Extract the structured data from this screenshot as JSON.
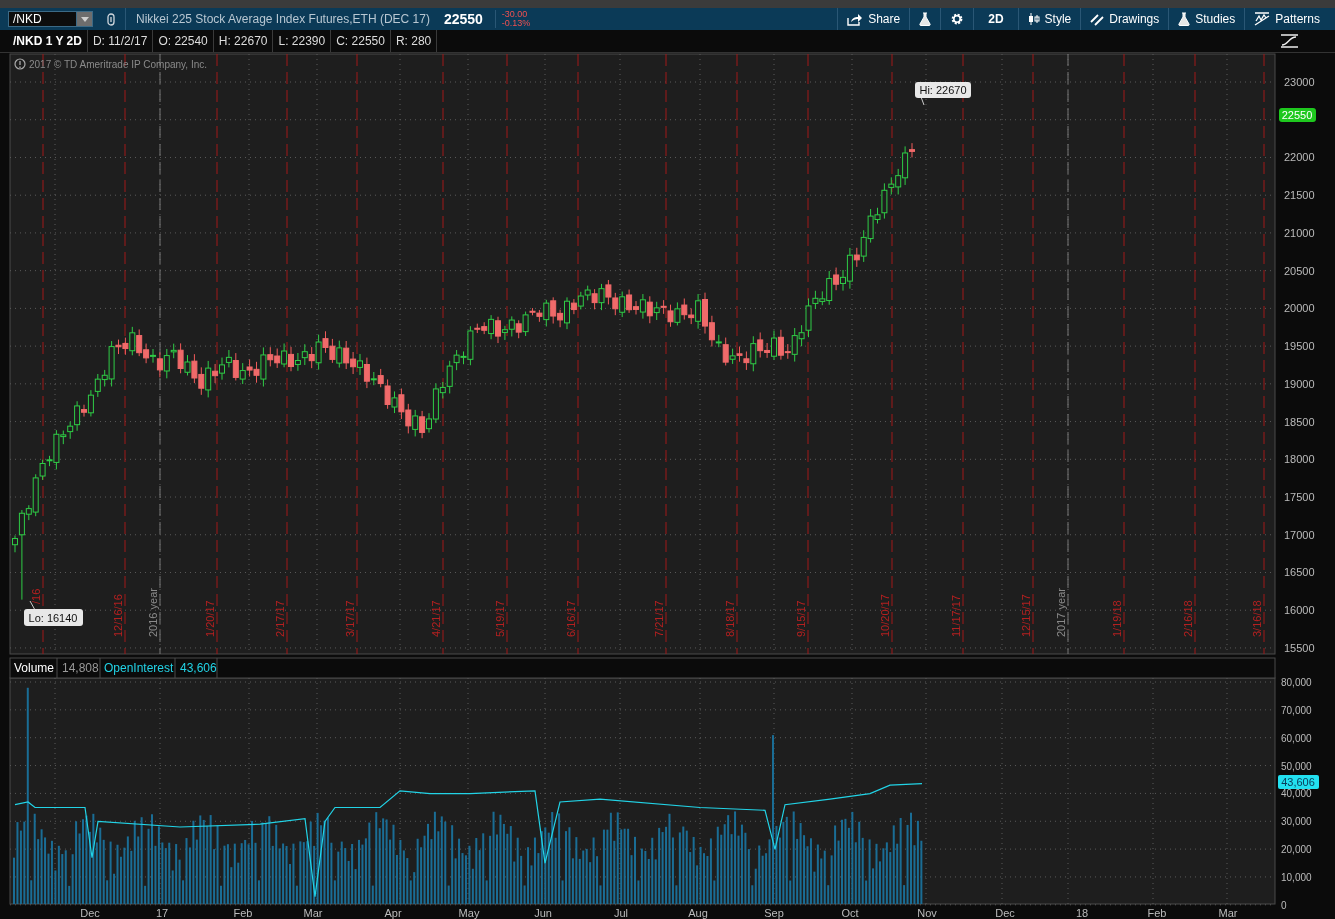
{
  "toolbar": {
    "symbol": "/NKD",
    "description": "Nikkei 225 Stock Average Index Futures,ETH (DEC 17)",
    "last": "22550",
    "change": "-30.00",
    "change_pct": "-0.13%",
    "buttons": [
      {
        "kind": "share",
        "label": "Share"
      },
      {
        "kind": "flask"
      },
      {
        "kind": "gear"
      },
      {
        "kind": "aggregation",
        "label": "2D"
      },
      {
        "kind": "style",
        "label": "Style"
      },
      {
        "kind": "drawings",
        "label": "Drawings"
      },
      {
        "kind": "studies",
        "label": "Studies"
      },
      {
        "kind": "patterns",
        "label": "Patterns"
      }
    ]
  },
  "header": {
    "title": "/NKD 1 Y 2D",
    "stats": [
      "D: 11/2/17",
      "O: 22540",
      "H: 22670",
      "L: 22390",
      "C: 22550",
      "R: 280"
    ]
  },
  "copyright": "2017 © TD Ameritrade IP Company, Inc.",
  "price_axis": [
    "23000",
    "22000",
    "21500",
    "21000",
    "20500",
    "20000",
    "19500",
    "19000",
    "18500",
    "18000",
    "17500",
    "17000",
    "16500",
    "16000",
    "15500"
  ],
  "last_price_badge": "22550",
  "date_labels": [
    {
      "kind": "date",
      "text": "/16"
    },
    {
      "kind": "date",
      "text": "12/16/16"
    },
    {
      "kind": "year",
      "text": "2016 year"
    },
    {
      "kind": "date",
      "text": "1/20/17"
    },
    {
      "kind": "date",
      "text": "2/17/17"
    },
    {
      "kind": "date",
      "text": "3/17/17"
    },
    {
      "kind": "date",
      "text": "4/21/17"
    },
    {
      "kind": "date",
      "text": "5/19/17"
    },
    {
      "kind": "date",
      "text": "6/16/17"
    },
    {
      "kind": "date",
      "text": "7/21/17"
    },
    {
      "kind": "date",
      "text": "8/18/17"
    },
    {
      "kind": "date",
      "text": "9/15/17"
    },
    {
      "kind": "date",
      "text": "10/20/17"
    },
    {
      "kind": "date",
      "text": "11/17/17"
    },
    {
      "kind": "date",
      "text": "12/15/17"
    },
    {
      "kind": "year",
      "text": "2017 year"
    },
    {
      "kind": "date",
      "text": "1/19/18"
    },
    {
      "kind": "date",
      "text": "2/16/18"
    },
    {
      "kind": "date",
      "text": "3/16/18"
    }
  ],
  "hi_label": "Hi: 22670",
  "lo_label": "Lo: 16140",
  "volume_legend": {
    "volume_label": "Volume",
    "volume": "14,808",
    "oi_label": "OpenInterest",
    "oi": "43,606"
  },
  "volume_axis": [
    "80,000",
    "70,000",
    "60,000",
    "50,000",
    "40,000",
    "30,000",
    "20,000",
    "10,000",
    "0"
  ],
  "oi_badge": "43,606",
  "months": [
    "Dec",
    "17",
    "Feb",
    "Mar",
    "Apr",
    "May",
    "Jun",
    "Jul",
    "Aug",
    "Sep",
    "Oct",
    "Nov",
    "Dec",
    "18",
    "Feb",
    "Mar"
  ]
}
